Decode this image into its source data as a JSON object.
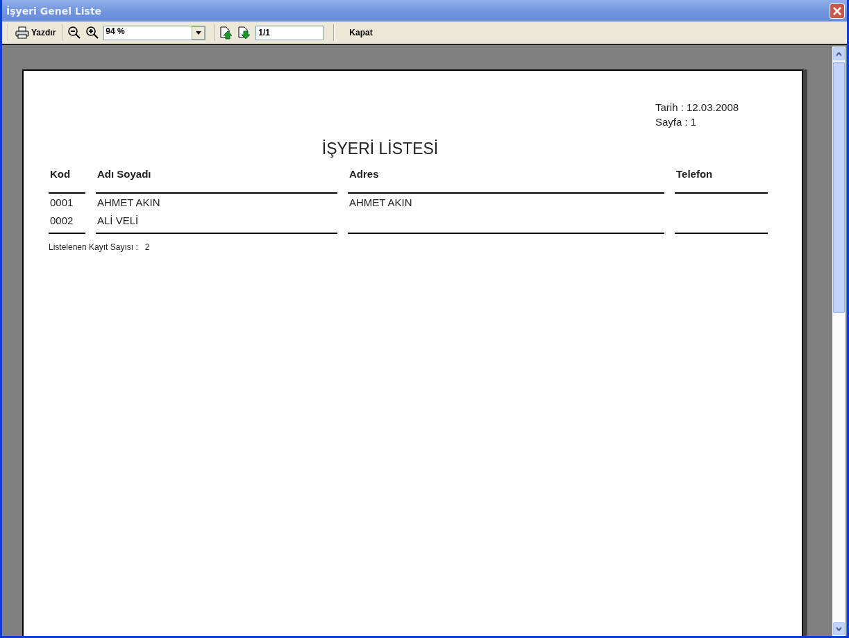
{
  "window": {
    "title": "İşyeri Genel Liste"
  },
  "toolbar": {
    "print_label": "Yazdır",
    "zoom": "94 %",
    "page": "1/1",
    "close_label": "Kapat"
  },
  "report": {
    "date_line": "Tarih  : 12.03.2008",
    "page_line": "Sayfa : 1",
    "title": "İŞYERİ LİSTESİ",
    "columns": [
      "Kod",
      "Adı Soyadı",
      "Adres",
      "Telefon"
    ],
    "rows": [
      {
        "kod": "0001",
        "adi_soyadi": "AHMET AKIN",
        "adres": "AHMET AKIN"
      },
      {
        "kod": "0002",
        "adi_soyadi": "ALİ VELİ"
      }
    ],
    "count_label": "Listelenen Kayıt Sayısı :",
    "count": "2"
  }
}
